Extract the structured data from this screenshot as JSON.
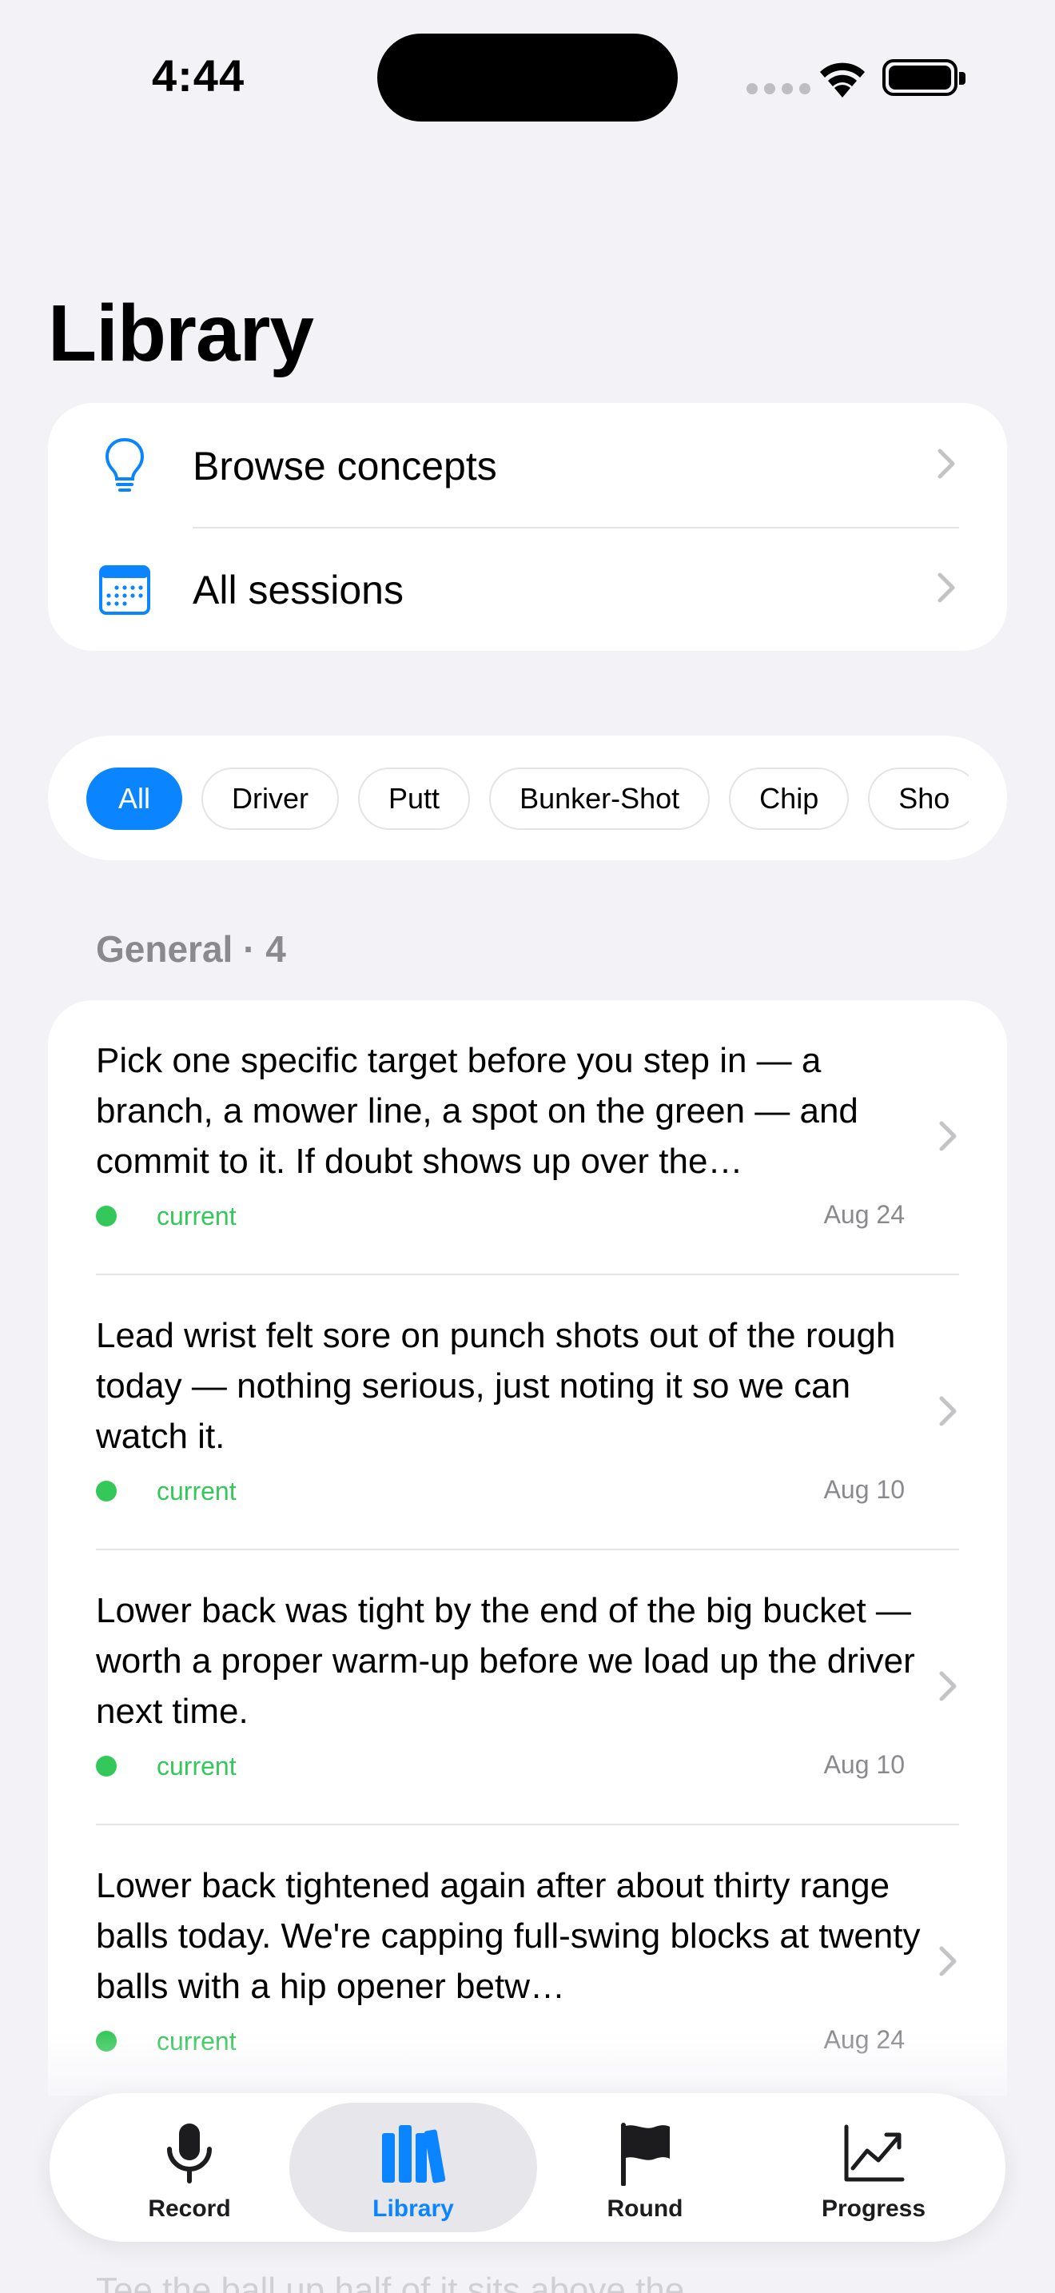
{
  "status_bar": {
    "time": "4:44"
  },
  "page": {
    "title": "Library"
  },
  "menu": {
    "items": [
      {
        "label": "Browse concepts",
        "icon": "lightbulb-icon"
      },
      {
        "label": "All sessions",
        "icon": "calendar-icon"
      }
    ]
  },
  "filters": {
    "chips": [
      "All",
      "Driver",
      "Putt",
      "Bunker-Shot",
      "Chip",
      "Sho"
    ],
    "selected": "All"
  },
  "section": {
    "header": "General · 4"
  },
  "notes": [
    {
      "text": "Pick one specific target before you step in — a branch, a mower line, a spot on the green — and commit to it. If doubt shows up over the…",
      "status": "current",
      "date": "Aug 24"
    },
    {
      "text": "Lead wrist felt sore on punch shots out of the rough today — nothing serious, just noting it so we can watch it.",
      "status": "current",
      "date": "Aug 10"
    },
    {
      "text": "Lower back was tight by the end of the big bucket — worth a proper warm-up before we load up the driver next time.",
      "status": "current",
      "date": "Aug 10"
    },
    {
      "text": "Lower back tightened again after about thirty range balls today. We're capping full-swing blocks at twenty balls with a hip opener betw…",
      "status": "current",
      "date": "Aug 24"
    }
  ],
  "ghost": {
    "text": "Tee the ball up half of it sits above the"
  },
  "tab_bar": {
    "tabs": [
      {
        "label": "Record",
        "icon": "microphone-icon"
      },
      {
        "label": "Library",
        "icon": "books-icon"
      },
      {
        "label": "Round",
        "icon": "flag-icon"
      },
      {
        "label": "Progress",
        "icon": "chart-line-icon"
      }
    ],
    "selected": "Library"
  },
  "colors": {
    "accent": "#0A84FF",
    "status_green": "#34C759",
    "background": "#F2F2F7"
  }
}
